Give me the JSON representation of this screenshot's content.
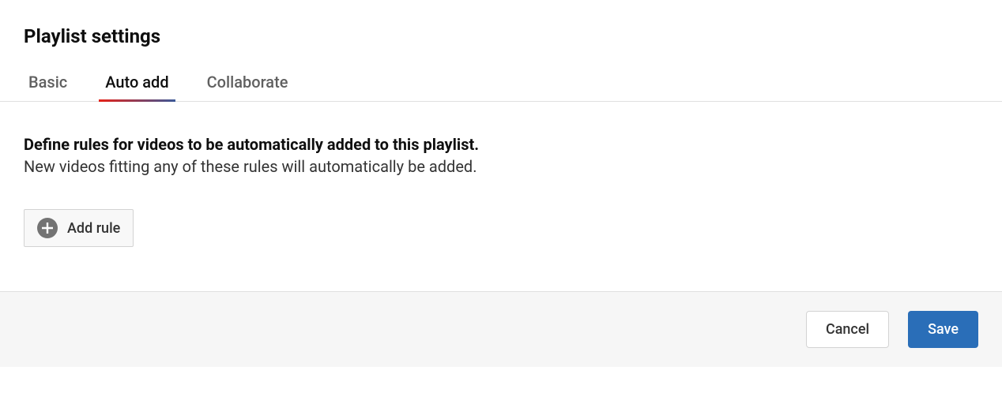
{
  "title": "Playlist settings",
  "tabs": [
    {
      "label": "Basic",
      "active": false
    },
    {
      "label": "Auto add",
      "active": true
    },
    {
      "label": "Collaborate",
      "active": false
    }
  ],
  "content": {
    "heading": "Define rules for videos to be automatically added to this playlist.",
    "sub": "New videos fitting any of these rules will automatically be added.",
    "add_rule_label": "Add rule"
  },
  "footer": {
    "cancel_label": "Cancel",
    "save_label": "Save"
  }
}
